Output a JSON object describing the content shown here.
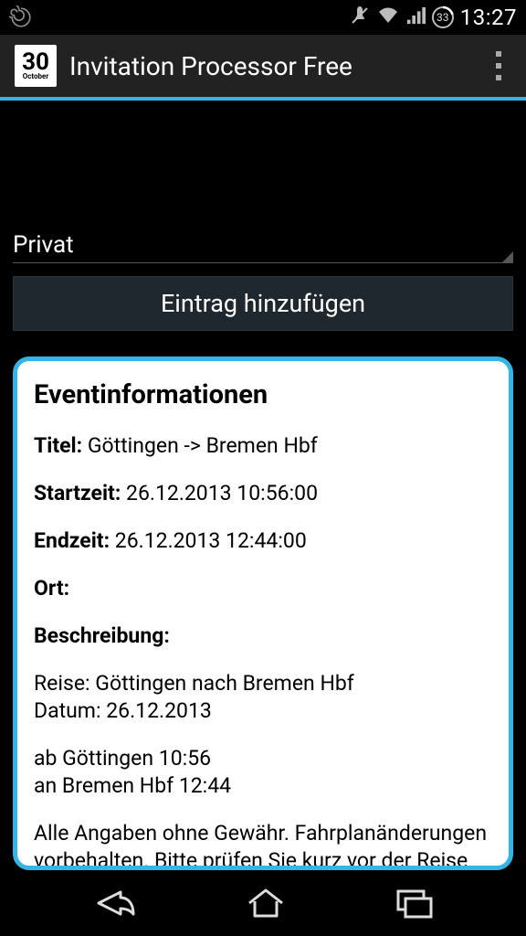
{
  "status": {
    "battery": "33",
    "time": "13:27"
  },
  "actionbar": {
    "icon_day": "30",
    "icon_month": "October",
    "title": "Invitation Processor Free"
  },
  "spinner": {
    "selected": "Privat"
  },
  "add_button": {
    "label": "Eintrag hinzufügen"
  },
  "event": {
    "heading": "Eventinformationen",
    "title_label": "Titel:",
    "title_value": "Göttingen -> Bremen Hbf",
    "start_label": "Startzeit:",
    "start_value": "26.12.2013 10:56:00",
    "end_label": "Endzeit:",
    "end_value": "26.12.2013 12:44:00",
    "location_label": "Ort:",
    "location_value": "",
    "desc_label": "Beschreibung:",
    "desc_line1": "Reise: Göttingen nach Bremen Hbf",
    "desc_line2": "Datum: 26.12.2013",
    "desc_line3": "ab Göttingen 10:56",
    "desc_line4": "an Bremen Hbf 12:44",
    "desc_line5": "Alle Angaben ohne Gewähr. Fahrplanänderungen vorbehalten. Bitte prüfen Sie kurz vor der Reise den aktuellen Fahrplan unter: www.bahn.de"
  }
}
